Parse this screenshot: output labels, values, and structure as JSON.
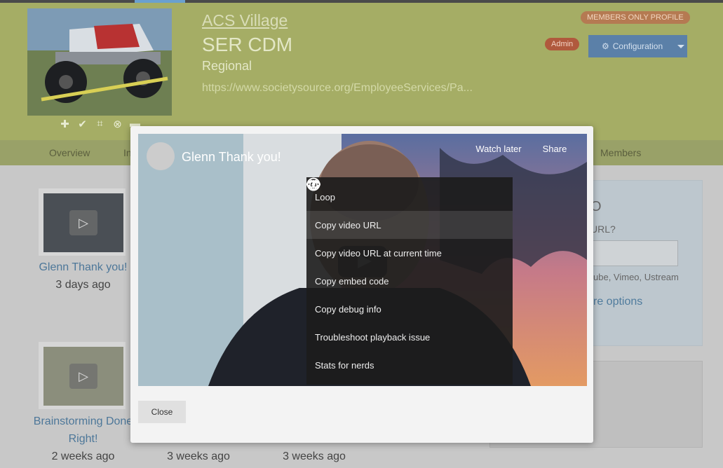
{
  "header": {
    "village_link": "ACS Village",
    "group_name": "SER CDM",
    "group_type": "Regional",
    "group_url": "https://www.societysource.org/EmployeeServices/Pa...",
    "members_badge": "MEMBERS ONLY PROFILE",
    "admin_badge": "Admin",
    "config_label": "Configuration"
  },
  "nav": {
    "items": [
      "Overview",
      "In",
      "Members"
    ]
  },
  "videos": [
    {
      "title": "Glenn Thank you!",
      "time": "3 days ago"
    },
    {
      "title_line1": "Brainstorming Done",
      "title_line2": "Right!",
      "time": "2 weeks ago"
    },
    {
      "time": "3 weeks ago"
    },
    {
      "time": "3 weeks ago"
    }
  ],
  "right_panel": {
    "heading_fragment": "O",
    "question_fragment": "URL?",
    "hint_fragment": "ube, Vimeo, Ustream",
    "more_fragment": "re options"
  },
  "modal": {
    "video_title": "Glenn Thank you!",
    "watch_later": "Watch later",
    "share": "Share",
    "menu": [
      {
        "label": "Loop",
        "icon": "loop-icon"
      },
      {
        "label": "Copy video URL",
        "icon": "link-icon"
      },
      {
        "label": "Copy video URL at current time",
        "icon": "link-icon"
      },
      {
        "label": "Copy embed code",
        "icon": "code-icon"
      },
      {
        "label": "Copy debug info",
        "icon": "bug-icon"
      },
      {
        "label": "Troubleshoot playback issue",
        "icon": "help-icon"
      },
      {
        "label": "Stats for nerds",
        "icon": "info-icon"
      }
    ],
    "close_label": "Close"
  }
}
